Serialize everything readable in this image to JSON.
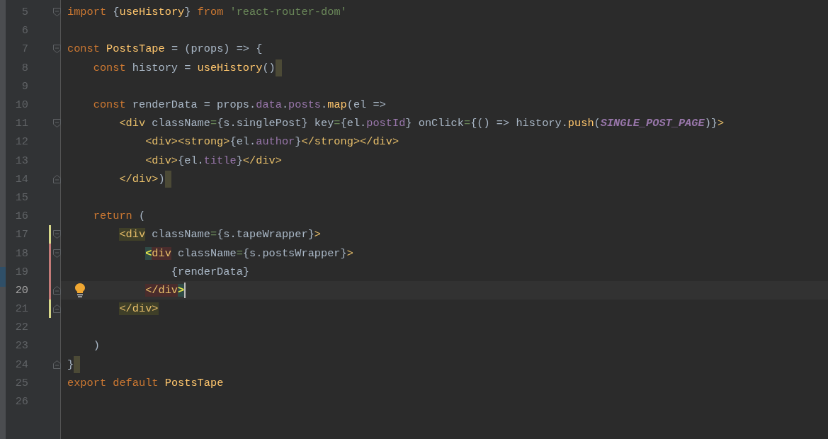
{
  "lines": [
    {
      "number": "5",
      "fold_start": true,
      "tokens": [
        {
          "text": "import ",
          "kind": "keyword"
        },
        {
          "text": "{",
          "kind": "text"
        },
        {
          "text": "useHistory",
          "kind": "function"
        },
        {
          "text": "} ",
          "kind": "text"
        },
        {
          "text": "from ",
          "kind": "keyword"
        },
        {
          "text": "'react-router-dom'",
          "kind": "string"
        }
      ]
    },
    {
      "number": "6"
    },
    {
      "number": "7",
      "fold_start": true,
      "tokens": [
        {
          "text": "const ",
          "kind": "keyword"
        },
        {
          "text": "PostsTape",
          "kind": "function"
        },
        {
          "text": " = (props) => {",
          "kind": "text"
        }
      ],
      "children": [
        {
          "number": "8",
          "end_marker": true,
          "tokens": [
            {
              "text": "const ",
              "kind": "keyword"
            },
            {
              "text": "history = ",
              "kind": "text"
            },
            {
              "text": "useHistory",
              "kind": "function"
            },
            {
              "text": "()",
              "kind": "text"
            }
          ]
        },
        {
          "number": "9"
        },
        {
          "number": "10",
          "tokens": [
            {
              "text": "const ",
              "kind": "keyword"
            },
            {
              "text": "renderData = props.",
              "kind": "text"
            },
            {
              "text": "data",
              "kind": "field"
            },
            {
              "text": ".",
              "kind": "text"
            },
            {
              "text": "posts",
              "kind": "field"
            },
            {
              "text": ".",
              "kind": "text"
            },
            {
              "text": "map",
              "kind": "function"
            },
            {
              "text": "(el =>",
              "kind": "text"
            }
          ],
          "children": [
            {
              "number": "11",
              "fold_start": true,
              "tokens": [
                {
                  "text": "<div",
                  "kind": "tag"
                },
                {
                  "text": " className",
                  "kind": "text"
                },
                {
                  "text": "=",
                  "kind": "operator"
                },
                {
                  "text": "{s.singlePost} key",
                  "kind": "text"
                },
                {
                  "text": "=",
                  "kind": "operator"
                },
                {
                  "text": "{el.",
                  "kind": "text"
                },
                {
                  "text": "postId",
                  "kind": "field"
                },
                {
                  "text": "} onClick",
                  "kind": "text"
                },
                {
                  "text": "=",
                  "kind": "operator"
                },
                {
                  "text": "{() => history.",
                  "kind": "text"
                },
                {
                  "text": "push",
                  "kind": "function"
                },
                {
                  "text": "(",
                  "kind": "text"
                },
                {
                  "text": "SINGLE_POST_PAGE",
                  "kind": "constant"
                },
                {
                  "text": ")}",
                  "kind": "text"
                },
                {
                  "text": ">",
                  "kind": "tag"
                }
              ],
              "children": [
                {
                  "number": "12",
                  "tokens": [
                    {
                      "text": "<div><strong>",
                      "kind": "tag"
                    },
                    {
                      "text": "{el.",
                      "kind": "text"
                    },
                    {
                      "text": "author",
                      "kind": "field"
                    },
                    {
                      "text": "}",
                      "kind": "text"
                    },
                    {
                      "text": "</strong></div>",
                      "kind": "tag"
                    }
                  ]
                },
                {
                  "number": "13",
                  "tokens": [
                    {
                      "text": "<div>",
                      "kind": "tag"
                    },
                    {
                      "text": "{el.",
                      "kind": "text"
                    },
                    {
                      "text": "title",
                      "kind": "field"
                    },
                    {
                      "text": "}",
                      "kind": "text"
                    },
                    {
                      "text": "</div>",
                      "kind": "tag"
                    }
                  ]
                }
              ]
            },
            {
              "number": "14",
              "fold_end": true,
              "end_marker": true,
              "tokens": [
                {
                  "text": "</div>",
                  "kind": "tag"
                },
                {
                  "text": ")",
                  "kind": "text"
                }
              ]
            }
          ]
        },
        {
          "number": "15"
        },
        {
          "number": "16",
          "tokens": [
            {
              "text": "return ",
              "kind": "keyword"
            },
            {
              "text": "(",
              "kind": "text"
            }
          ],
          "children": [
            {
              "number": "17",
              "fold_start": true,
              "modified": true,
              "tokens": [
                {
                  "text": "<div",
                  "kind": "tag",
                  "paired": true
                },
                {
                  "text": " className",
                  "kind": "text"
                },
                {
                  "text": "=",
                  "kind": "operator"
                },
                {
                  "text": "{s.tapeWrapper}",
                  "kind": "text"
                },
                {
                  "text": ">",
                  "kind": "tag"
                }
              ],
              "children": [
                {
                  "number": "18",
                  "fold_start": true,
                  "edited": true,
                  "tokens": [
                    {
                      "text": "<",
                      "kind": "bright",
                      "bracket": true
                    },
                    {
                      "text": "div",
                      "kind": "tag",
                      "mismatched": true
                    },
                    {
                      "text": " className",
                      "kind": "text"
                    },
                    {
                      "text": "=",
                      "kind": "operator"
                    },
                    {
                      "text": "{s.postsWrapper}",
                      "kind": "text"
                    },
                    {
                      "text": ">",
                      "kind": "tag"
                    }
                  ],
                  "children": [
                    {
                      "number": "19",
                      "edited": true,
                      "tokens": [
                        {
                          "text": "{renderData}",
                          "kind": "text"
                        }
                      ]
                    }
                  ]
                },
                {
                  "number": "20",
                  "fold_end": true,
                  "edited": true,
                  "current": true,
                  "intention": true,
                  "tokens": [
                    {
                      "text": "</div",
                      "kind": "tag",
                      "mismatched": true
                    },
                    {
                      "text": ">",
                      "kind": "bright",
                      "bracket": true
                    }
                  ]
                }
              ]
            },
            {
              "number": "21",
              "fold_end": true,
              "modified": true,
              "tokens": [
                {
                  "text": "</div>",
                  "kind": "tag",
                  "paired": true
                }
              ]
            },
            {
              "number": "22"
            }
          ]
        },
        {
          "number": "23",
          "tokens": [
            {
              "text": ")",
              "kind": "text"
            }
          ]
        }
      ]
    },
    {
      "number": "24",
      "fold_end": true,
      "end_marker": true,
      "tokens": [
        {
          "text": "}",
          "kind": "text"
        }
      ]
    },
    {
      "number": "25",
      "tokens": [
        {
          "text": "export ",
          "kind": "keyword"
        },
        {
          "text": "default ",
          "kind": "keyword"
        },
        {
          "text": "PostsTape",
          "kind": "function"
        }
      ]
    },
    {
      "number": "26"
    }
  ]
}
